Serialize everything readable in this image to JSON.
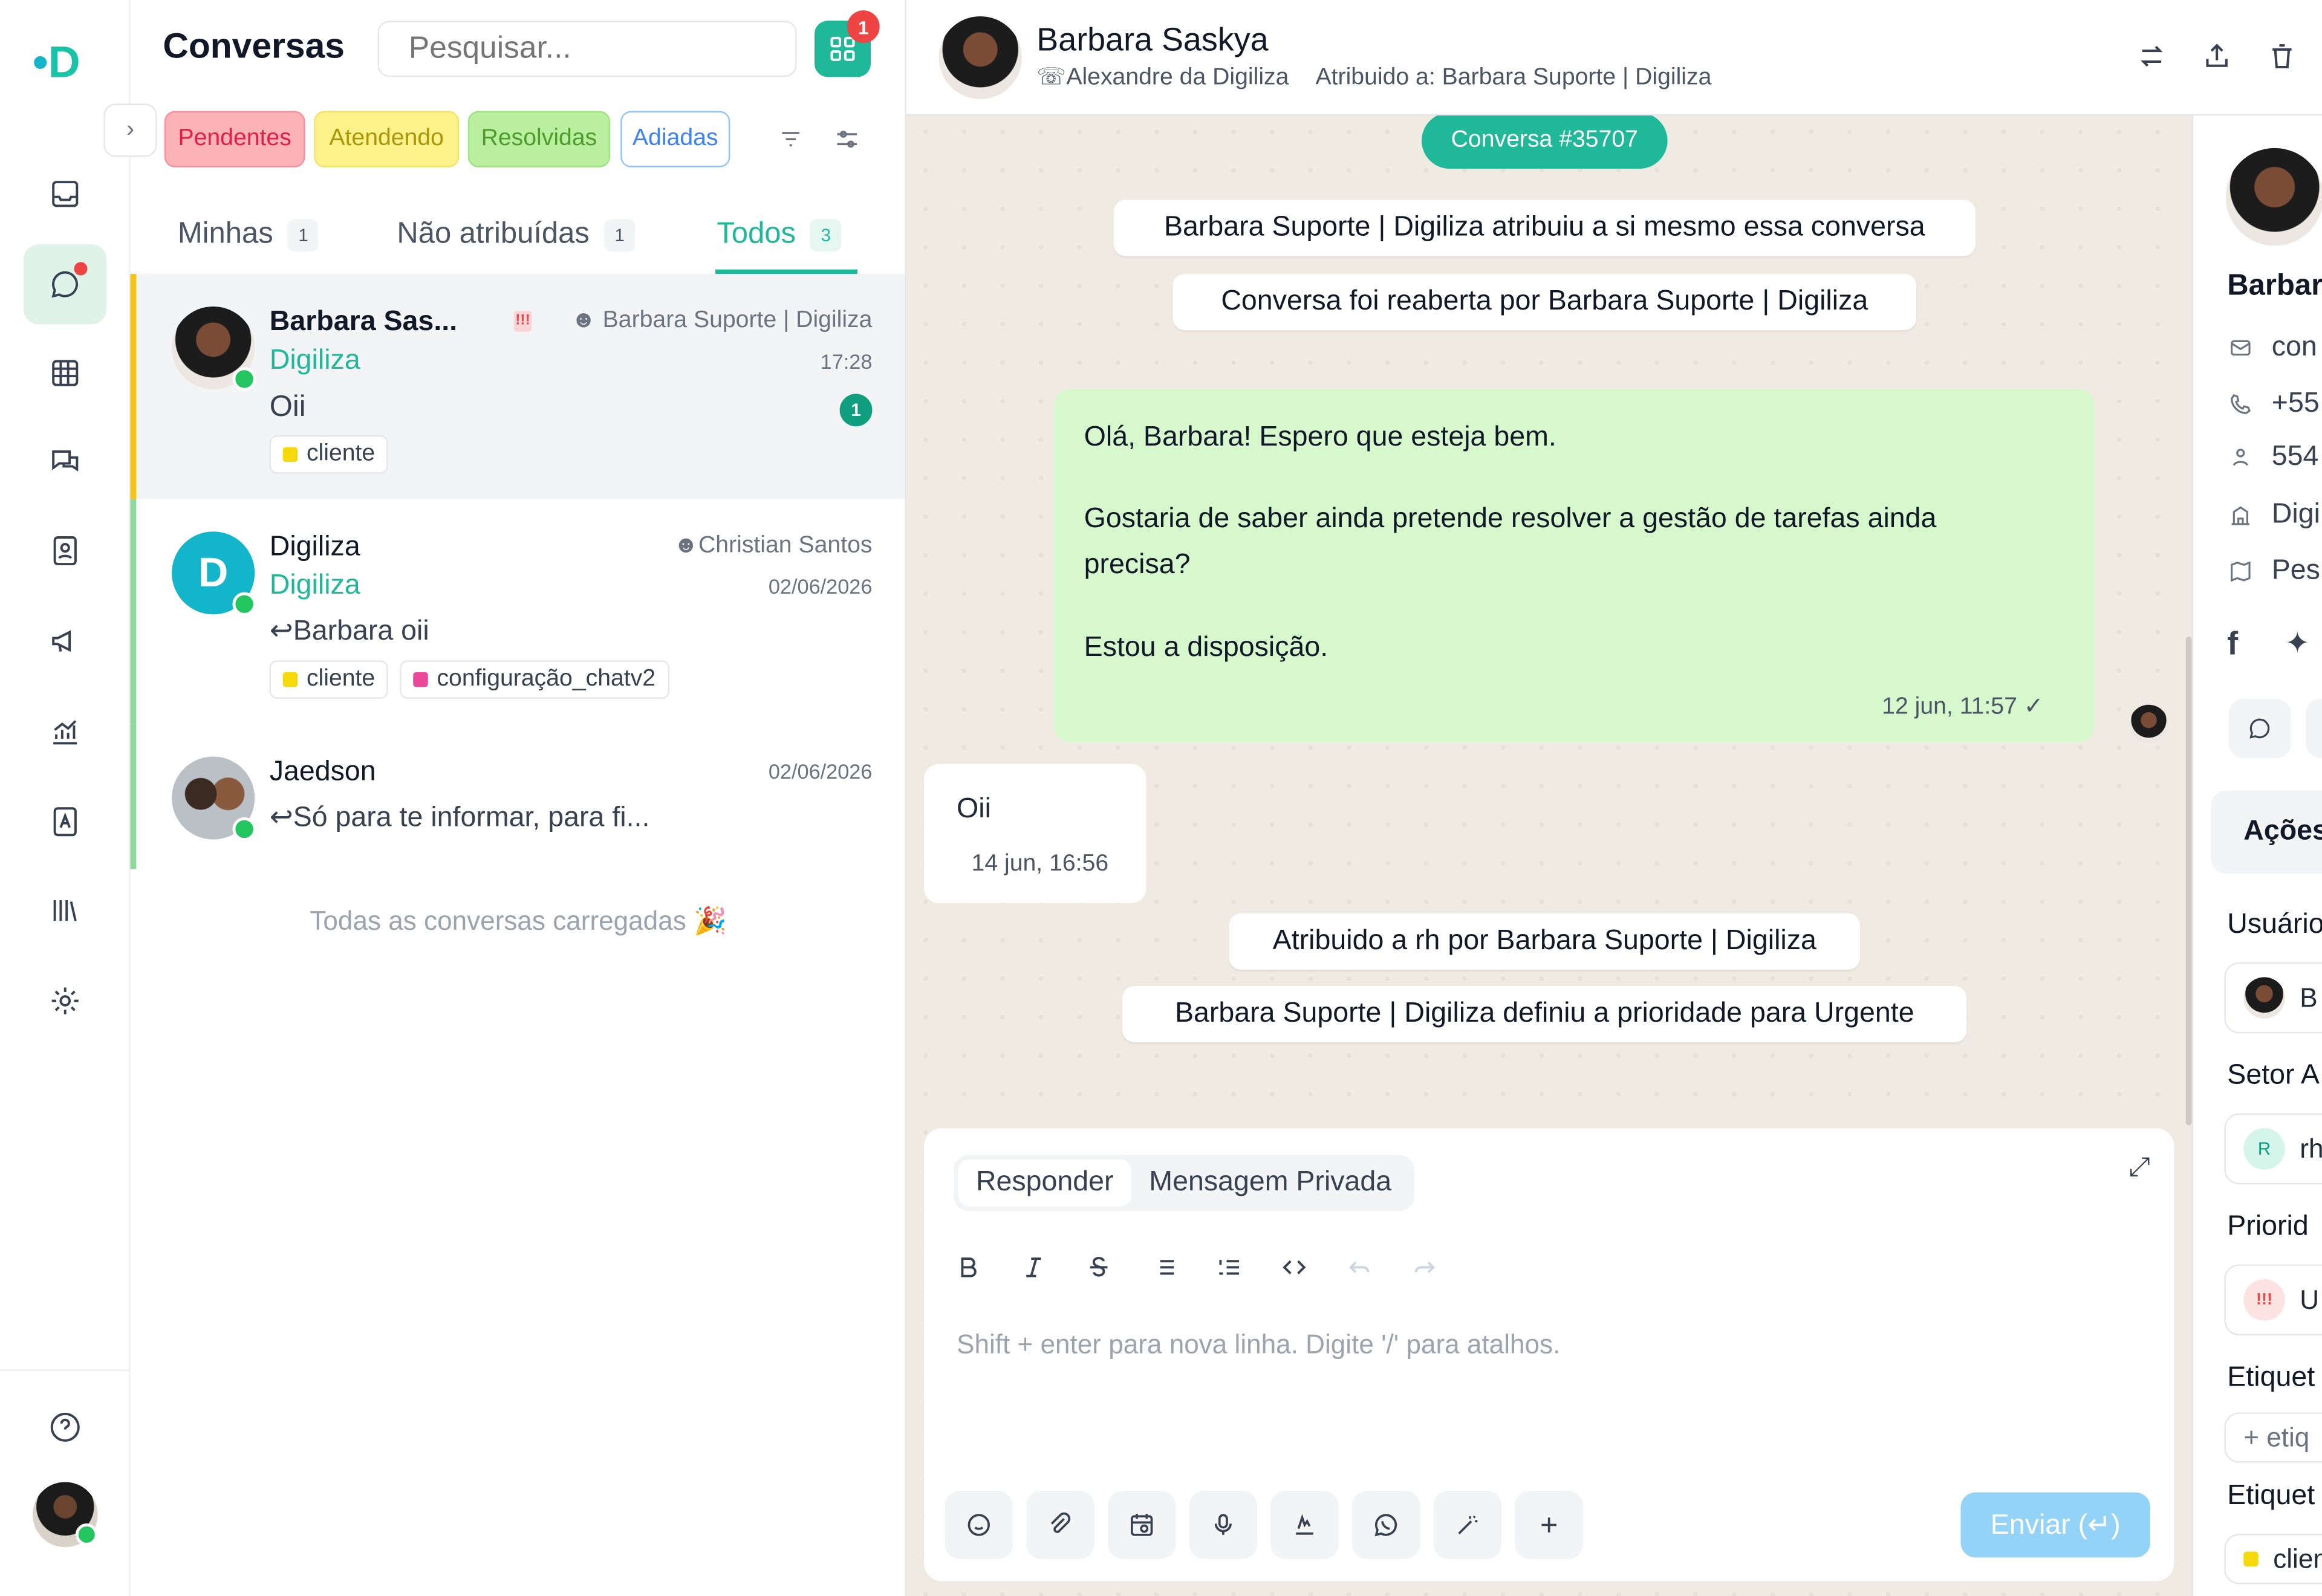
{
  "sidebar": {
    "logo": "D",
    "items": [
      "inbox-icon",
      "chat-icon",
      "grid-icon",
      "messages-icon",
      "contacts-icon",
      "megaphone-icon",
      "analytics-icon",
      "reports-icon",
      "library-icon",
      "settings-icon"
    ],
    "active": "chat-icon",
    "help_icon": "help-icon"
  },
  "list": {
    "title": "Conversas",
    "search_placeholder": "Pesquisar...",
    "notif_count": "1",
    "filters": [
      {
        "label": "Pendentes",
        "bg": "#fbb3b6",
        "fg": "#e11d48",
        "border": "#f98ea0"
      },
      {
        "label": "Atendendo",
        "bg": "#fdf28a",
        "fg": "#a9960a",
        "border": "#f4e466"
      },
      {
        "label": "Resolvidas",
        "bg": "#b9ef9f",
        "fg": "#4e9c2c",
        "border": "#9fe484"
      },
      {
        "label": "Adiadas",
        "bg": "#ffffff",
        "fg": "#3b82f6",
        "border": "#93c5fd"
      }
    ],
    "tabs": [
      {
        "label": "Minhas",
        "count": "1"
      },
      {
        "label": "Não atribuídas",
        "count": "1"
      },
      {
        "label": "Todos",
        "count": "3"
      }
    ],
    "conversations": [
      {
        "name": "Barbara Sas...",
        "org": "Digiliza",
        "assignee": "Barbara Suporte | Digiliza",
        "time": "17:28",
        "message": "Oii",
        "unread": "1",
        "tags": [
          {
            "label": "cliente",
            "color": "#f5d90a"
          }
        ]
      },
      {
        "name": "Digiliza",
        "org": "Digiliza",
        "assignee": "Christian Santos",
        "time": "02/06/2026",
        "message": "Barbara oii",
        "tags": [
          {
            "label": "cliente",
            "color": "#f5d90a"
          },
          {
            "label": "configuração_chatv2",
            "color": "#ec4899"
          }
        ]
      },
      {
        "name": "Jaedson",
        "time": "02/06/2026",
        "message": "Só para te informar, para fi..."
      }
    ],
    "all_loaded": "Todas as conversas carregadas 🎉"
  },
  "chat": {
    "contact_name": "Barbara Saskya",
    "channel": "Alexandre da Digiliza",
    "assigned": "Atribuido a: Barbara Suporte | Digiliza",
    "conversation_id": "Conversa #35707",
    "system_messages": [
      "Barbara Suporte | Digiliza atribuiu a si mesmo essa conversa",
      "Conversa foi reaberta por Barbara Suporte | Digiliza",
      "Atribuido a rh por Barbara Suporte | Digiliza",
      "Barbara Suporte | Digiliza definiu a prioridade para Urgente"
    ],
    "outgoing": {
      "lines": [
        "Olá, Barbara! Espero que esteja bem.",
        "Gostaria de saber ainda pretende resolver a gestão de tarefas ainda",
        "precisa?",
        "Estou a disposição."
      ],
      "time": "12 jun, 11:57"
    },
    "incoming": {
      "text": "Oii",
      "time": "14 jun, 16:56"
    },
    "composer": {
      "tab_reply": "Responder",
      "tab_private": "Mensagem Privada",
      "placeholder": "Shift + enter para nova linha. Digite '/' para atalhos.",
      "send": "Enviar (↵)"
    }
  },
  "contact": {
    "name": "Barbar",
    "email": "con",
    "phone": "+55",
    "id": "554",
    "company": "Digi",
    "extra": "Pes",
    "actions": "Ações",
    "user_label": "Usuário",
    "user_initial": "B",
    "sector_label": "Setor A",
    "sector_value": "rh",
    "sector_initial": "R",
    "priority_label": "Priorid",
    "priority_value": "U",
    "labels_label": "Etiquet",
    "add_label": "+ etiq",
    "labels2_label": "Etiquet",
    "label_value": "clien"
  }
}
